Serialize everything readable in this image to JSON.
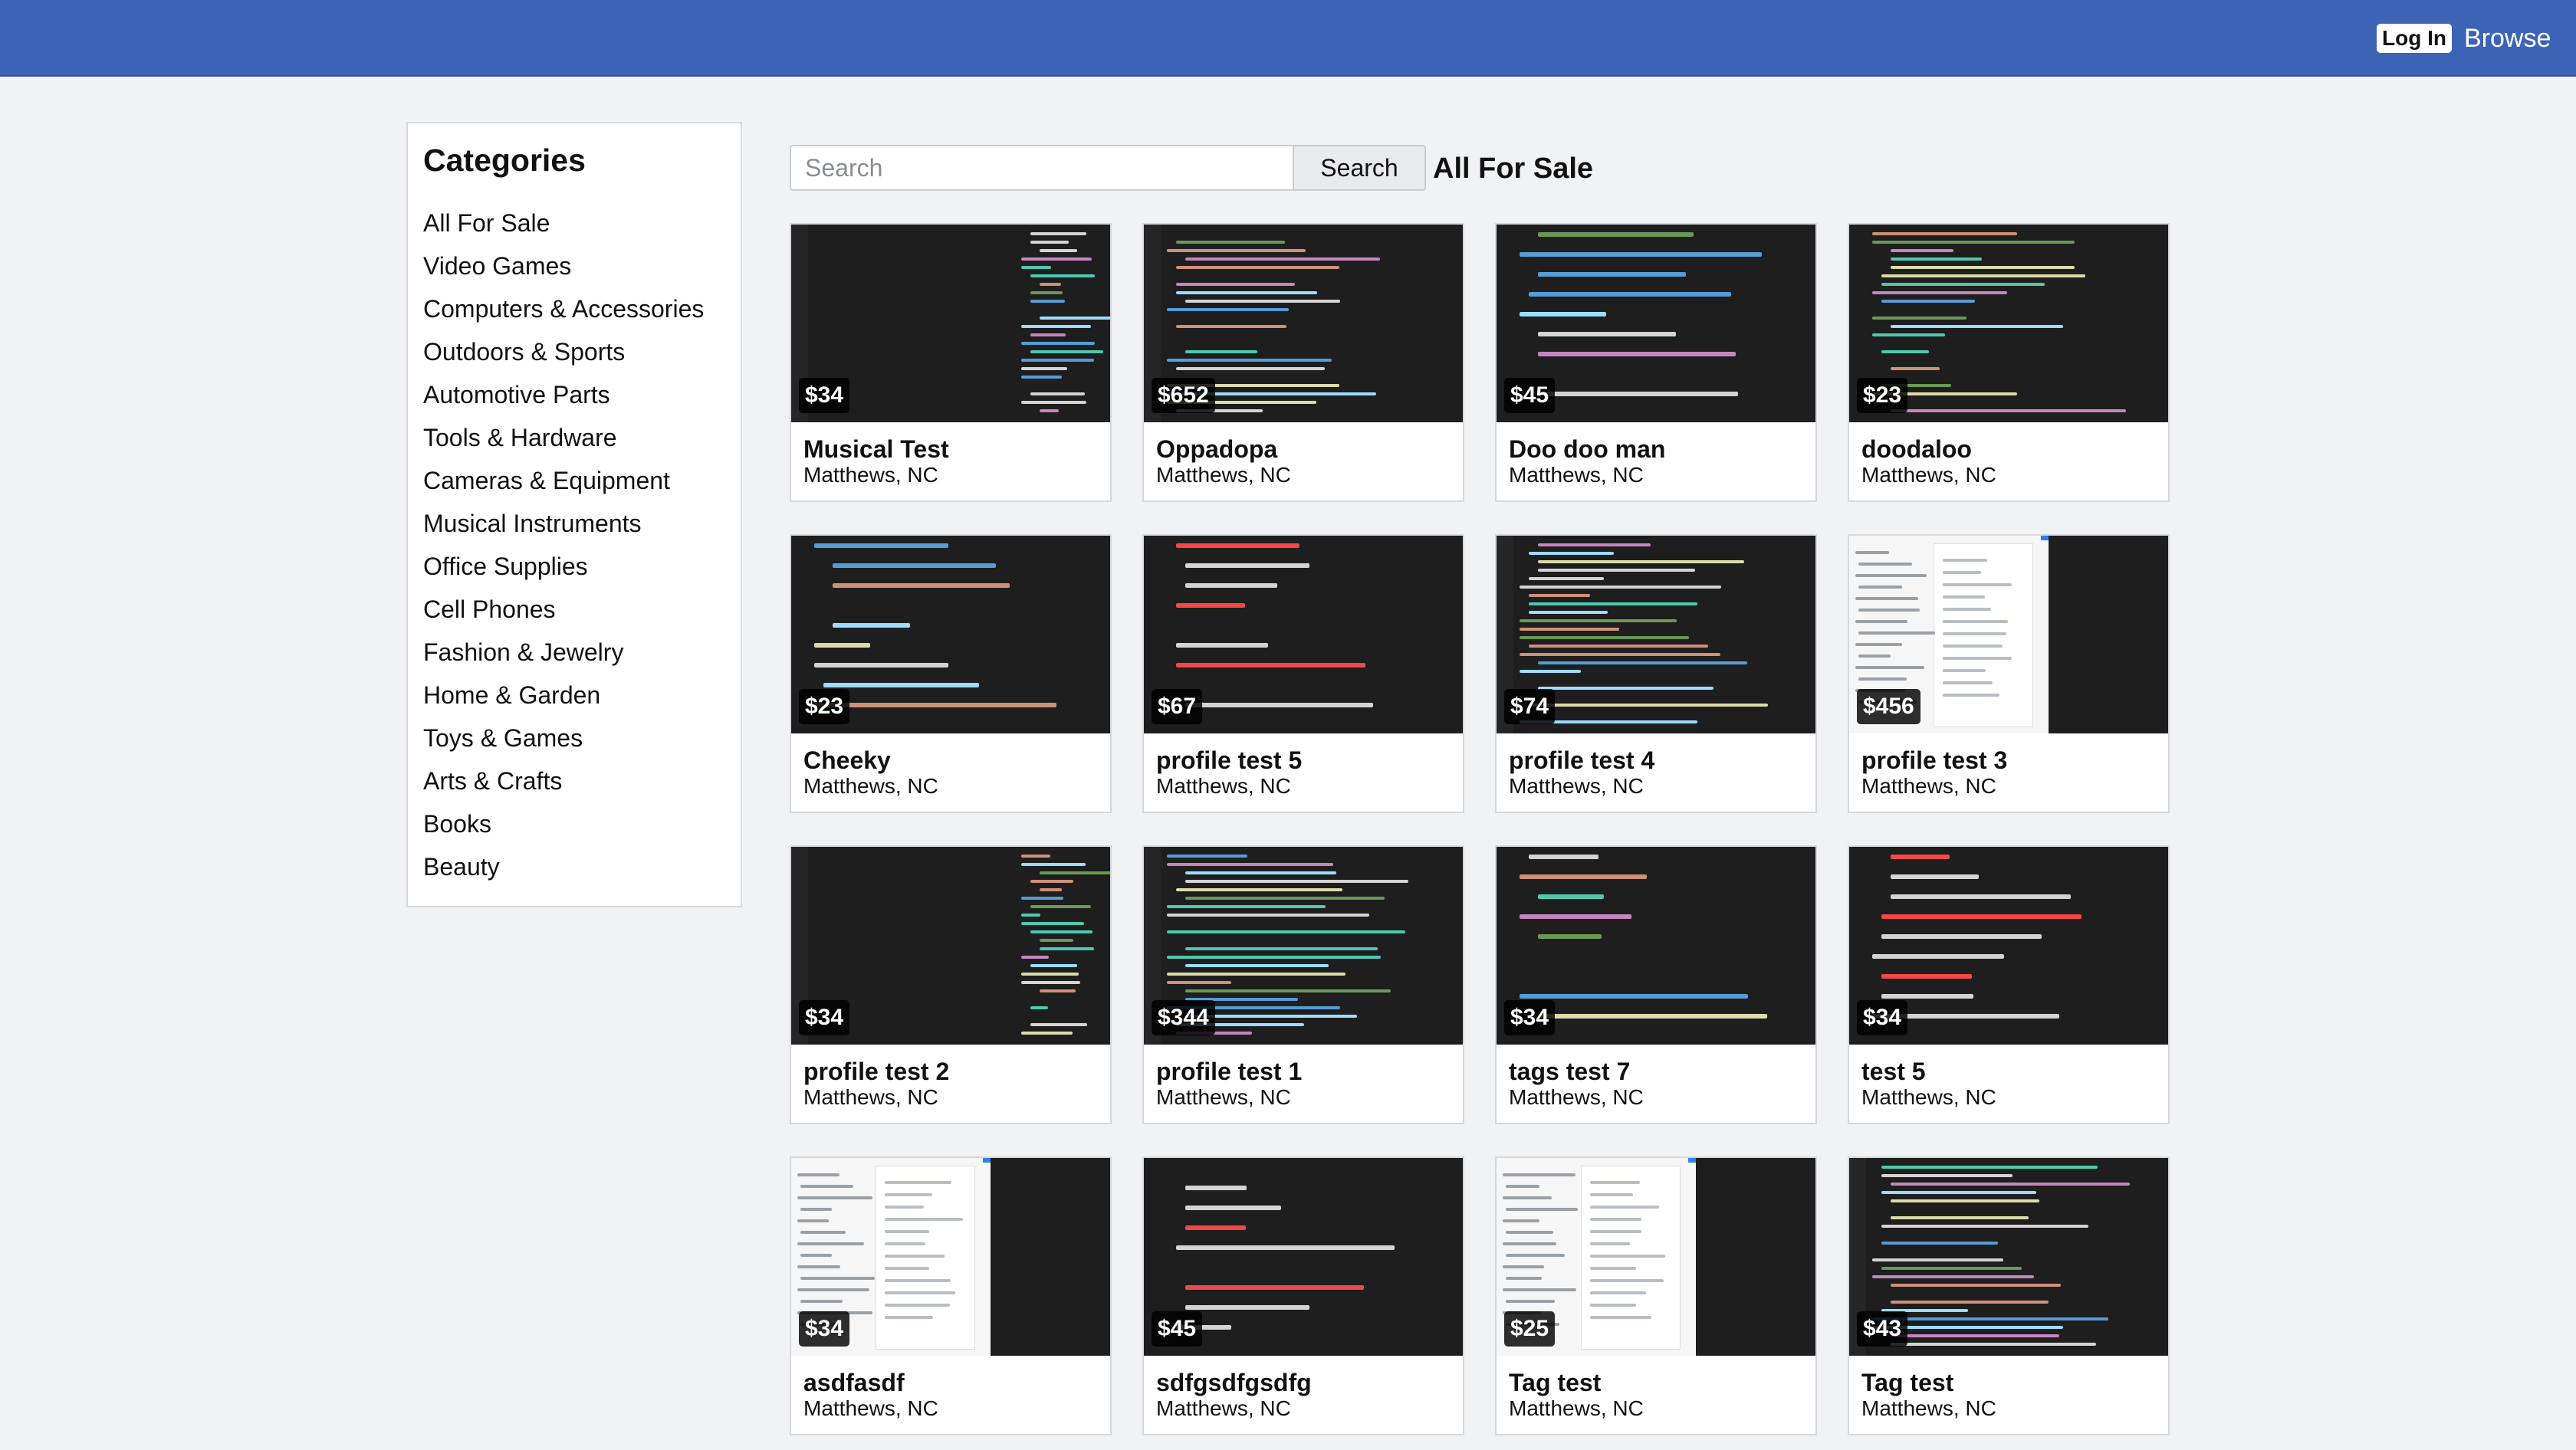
{
  "header": {
    "login_label": "Log In",
    "browse_label": "Browse"
  },
  "sidebar": {
    "title": "Categories",
    "items": [
      "All For Sale",
      "Video Games",
      "Computers & Accessories",
      "Outdoors & Sports",
      "Automotive Parts",
      "Tools & Hardware",
      "Cameras & Equipment",
      "Musical Instruments",
      "Office Supplies",
      "Cell Phones",
      "Fashion & Jewelry",
      "Home & Garden",
      "Toys & Games",
      "Arts & Crafts",
      "Books",
      "Beauty"
    ]
  },
  "search": {
    "placeholder": "Search",
    "button_label": "Search"
  },
  "main": {
    "section_title": "All For Sale"
  },
  "listings": [
    {
      "title": "Musical Test",
      "location": "Matthews, NC",
      "price": "$34",
      "thumb": "code-split"
    },
    {
      "title": "Oppadopa",
      "location": "Matthews, NC",
      "price": "$652",
      "thumb": "code-dense"
    },
    {
      "title": "Doo doo man",
      "location": "Matthews, NC",
      "price": "$45",
      "thumb": "code-large"
    },
    {
      "title": "doodaloo",
      "location": "Matthews, NC",
      "price": "$23",
      "thumb": "code-config"
    },
    {
      "title": "Cheeky",
      "location": "Matthews, NC",
      "price": "$23",
      "thumb": "code-large"
    },
    {
      "title": "profile test 5",
      "location": "Matthews, NC",
      "price": "$67",
      "thumb": "code-red"
    },
    {
      "title": "profile test 4",
      "location": "Matthews, NC",
      "price": "$74",
      "thumb": "code-dense"
    },
    {
      "title": "profile test 3",
      "location": "Matthews, NC",
      "price": "$456",
      "thumb": "browser-split"
    },
    {
      "title": "profile test 2",
      "location": "Matthews, NC",
      "price": "$34",
      "thumb": "code-split"
    },
    {
      "title": "profile test 1",
      "location": "Matthews, NC",
      "price": "$344",
      "thumb": "code-dense"
    },
    {
      "title": "tags test 7",
      "location": "Matthews, NC",
      "price": "$34",
      "thumb": "code-large"
    },
    {
      "title": "test 5",
      "location": "Matthews, NC",
      "price": "$34",
      "thumb": "code-red"
    },
    {
      "title": "asdfasdf",
      "location": "Matthews, NC",
      "price": "$34",
      "thumb": "browser-split"
    },
    {
      "title": "sdfgsdfgsdfg",
      "location": "Matthews, NC",
      "price": "$45",
      "thumb": "code-red"
    },
    {
      "title": "Tag test",
      "location": "Matthews, NC",
      "price": "$25",
      "thumb": "browser-split"
    },
    {
      "title": "Tag test",
      "location": "Matthews, NC",
      "price": "$43",
      "thumb": "code-tree"
    }
  ]
}
